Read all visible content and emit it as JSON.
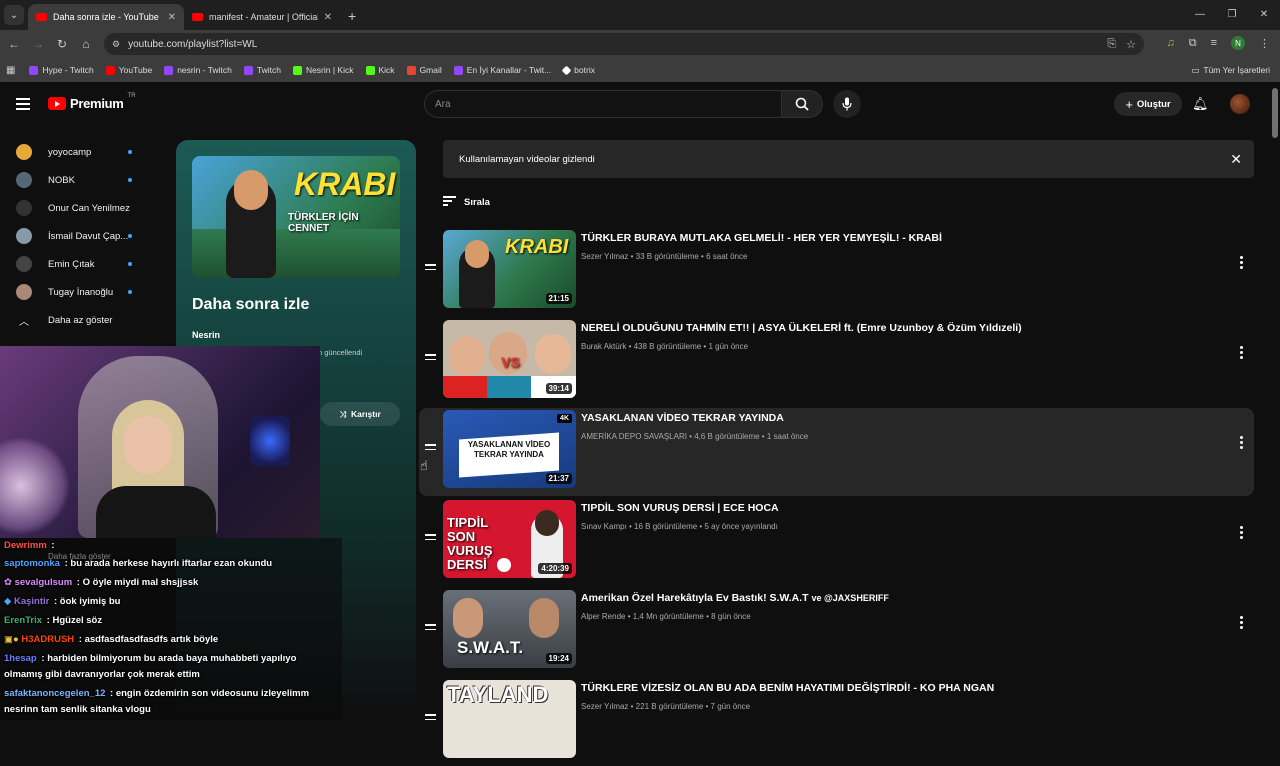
{
  "browser": {
    "tabs": [
      {
        "title": "Daha sonra izle - YouTube",
        "active": true
      },
      {
        "title": "manifest - Amateur | Official M",
        "active": false
      }
    ],
    "url": "youtube.com/playlist?list=WL",
    "profile_initial": "N",
    "bookmarks": [
      {
        "label": "Hype - Twitch",
        "color": "#9146ff"
      },
      {
        "label": "YouTube",
        "color": "#ff0000"
      },
      {
        "label": "nesrin - Twitch",
        "color": "#9146ff"
      },
      {
        "label": "Twitch",
        "color": "#9146ff"
      },
      {
        "label": "Nesrin | Kick",
        "color": "#53fc18"
      },
      {
        "label": "Kick",
        "color": "#53fc18"
      },
      {
        "label": "Gmail",
        "color": "#ea4335"
      },
      {
        "label": "En İyi Kanallar - Twit...",
        "color": "#9146ff"
      },
      {
        "label": "botrix",
        "color": "#ffffff"
      }
    ],
    "all_bookmarks": "Tüm Yer İşaretleri"
  },
  "header": {
    "logo": "Premium",
    "region": "TR",
    "search_placeholder": "Ara",
    "create_label": "Oluştur"
  },
  "sidebar": {
    "items": [
      {
        "label": "yoyocamp",
        "color": "#e8a838",
        "dot": true
      },
      {
        "label": "NOBK",
        "color": "#556677",
        "dot": true
      },
      {
        "label": "Onur Can Yenilmez",
        "color": "#333333",
        "dot": false
      },
      {
        "label": "İsmail Davut Çap...",
        "color": "#8899aa",
        "dot": true
      },
      {
        "label": "Emin Çıtak",
        "color": "#444444",
        "dot": true
      },
      {
        "label": "Tugay İnanoğlu",
        "color": "#aa8877",
        "dot": true
      }
    ],
    "show_less": "Daha az göster"
  },
  "playlist": {
    "title": "Daha sonra izle",
    "owner": "Nesrin",
    "updated": "n güncellendi",
    "shuffle_label": "Karıştır",
    "thumb_text_1": "KRABI",
    "thumb_text_2": "TÜRKLER İÇİN CENNET"
  },
  "notice": {
    "text": "Kullanılamayan videolar gizlendi"
  },
  "sort_label": "Sırala",
  "videos": [
    {
      "title": "TÜRKLER BURAYA MUTLAKA GELMELİ! - HER YER YEMYEŞİL! - KRABİ",
      "meta": "Sezer Yılmaz • 33 B görüntüleme • 6 saat önce",
      "duration": "21:15",
      "bg": "#3a8a6a",
      "thumb_text": "KRABI"
    },
    {
      "title": "NERELİ OLDUĞUNU TAHMİN ET!! | ASYA ÜLKELERİ ft. (Emre Uzunboy & Özüm Yıldızeli)",
      "meta": "Burak Aktürk • 438 B görüntüleme • 1 gün önce",
      "duration": "39:14",
      "bg": "#c7b9a8",
      "thumb_text": "VS"
    },
    {
      "title": "YASAKLANAN VİDEO TEKRAR YAYINDA",
      "meta": "AMERİKA DEPO SAVAŞLARI • 4,6 B görüntüleme • 1 saat önce",
      "duration": "21:37",
      "bg": "#1e3f8a",
      "thumb_text": "YASAKLANAN VİDEO TEKRAR YAYINDA"
    },
    {
      "title": "TIPDİL SON VURUŞ DERSİ | ECE HOCA",
      "meta": "Sınav Kampı • 16 B görüntüleme • 5 ay önce yayınlandı",
      "duration": "4:20:39",
      "bg": "#d4172f",
      "thumb_text": "TIPDİL SON VURUŞ DERSİ"
    },
    {
      "title": "Amerikan Özel Harekâtıyla Ev Bastık! S.W.A.T",
      "title_suffix": "ve @JAXSHERIFF",
      "meta": "Alper Rende • 1,4 Mn görüntüleme • 8 gün önce",
      "duration": "19:24",
      "bg": "#4a5058",
      "thumb_text": "S.W.A.T."
    },
    {
      "title": "TÜRKLERE VİZESİZ OLAN BU ADA BENİM HAYATIMI DEĞİŞTİRDİ! - KO PHA NGAN",
      "meta": "Sezer Yılmaz • 221 B görüntüleme • 7 gün önce",
      "duration": "",
      "bg": "#e7e3d8",
      "thumb_text": "TAYLAND"
    }
  ],
  "chat": [
    {
      "user": "Dewrimm",
      "sep": " :",
      "text": "",
      "color": "#ff4d4d"
    },
    {
      "user": "saptomonka",
      "sep": " :",
      "text": " bu arada herkese hayırlı iftarlar ezan okundu",
      "color": "#4da6ff"
    },
    {
      "user": "sevalgulsum",
      "sep": " :",
      "text": " O öyle miydi mal shsjjssk",
      "color": "#d98cff"
    },
    {
      "user": "Kaşintir",
      "sep": " :",
      "text": " öok iyimiş bu",
      "color": "#9370db"
    },
    {
      "user": "ErenTrix",
      "sep": " :",
      "text": " Hgüzel söz",
      "color": "#3cb371"
    },
    {
      "user": "H3ADRUSH",
      "sep": " :",
      "text": " asdfasdfasdfasdfs artık böyle",
      "color": "#ff4500"
    },
    {
      "user": "1hesap",
      "sep": " :",
      "text": " harbiden bilmiyorum bu arada baya muhabbeti yapılıyo",
      "color": "#6a7fff"
    },
    {
      "user": "",
      "sep": "",
      "text": "olmamış gibi davranıyorlar çok merak ettim",
      "color": "#ffffff"
    },
    {
      "user": "safaktanoncegelen_12",
      "sep": " :",
      "text": " engin özdemirin son videosunu izleyelimm",
      "color": "#7ab6ff"
    },
    {
      "user": "",
      "sep": "",
      "text": "nesrinn tam senlik sitanka vlogu",
      "color": "#ffffff"
    }
  ],
  "ghost_labels": {
    "show_more": "Daha fazla göster"
  }
}
